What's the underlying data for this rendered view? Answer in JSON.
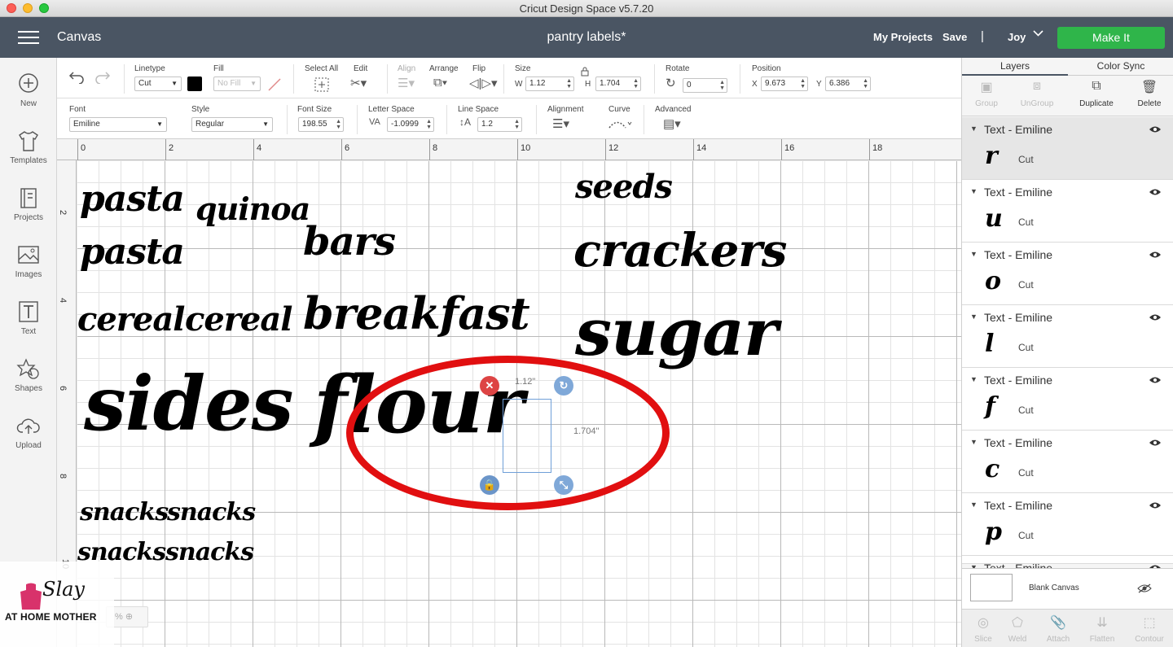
{
  "window": {
    "title": "Cricut Design Space  v5.7.20"
  },
  "header": {
    "section": "Canvas",
    "project_name": "pantry labels*",
    "my_projects": "My Projects",
    "save": "Save",
    "separator": "|",
    "user": "Joy",
    "make_it": "Make It"
  },
  "sidebar": {
    "items": [
      {
        "label": "New",
        "icon": "plus-circle-icon"
      },
      {
        "label": "Templates",
        "icon": "shirt-icon"
      },
      {
        "label": "Projects",
        "icon": "projects-icon"
      },
      {
        "label": "Images",
        "icon": "image-icon"
      },
      {
        "label": "Text",
        "icon": "text-icon"
      },
      {
        "label": "Shapes",
        "icon": "shapes-icon"
      },
      {
        "label": "Upload",
        "icon": "upload-icon"
      }
    ]
  },
  "toolbar": {
    "linetype_label": "Linetype",
    "linetype_value": "Cut",
    "fill_label": "Fill",
    "fill_value": "No Fill",
    "select_all": "Select All",
    "edit": "Edit",
    "align": "Align",
    "arrange": "Arrange",
    "flip": "Flip",
    "size_label": "Size",
    "w_label": "W",
    "w_value": "1.12",
    "h_label": "H",
    "h_value": "1.704",
    "rotate_label": "Rotate",
    "rotate_value": "0",
    "position_label": "Position",
    "x_label": "X",
    "x_value": "9.673",
    "y_label": "Y",
    "y_value": "6.386",
    "swatch_color": "#000000"
  },
  "text_toolbar": {
    "font_label": "Font",
    "font_value": "Emiline",
    "style_label": "Style",
    "style_value": "Regular",
    "font_size_label": "Font Size",
    "font_size_value": "198.55",
    "letter_space_label": "Letter Space",
    "letter_space_value": "-1.0999",
    "line_space_label": "Line Space",
    "line_space_value": "1.2",
    "alignment_label": "Alignment",
    "curve_label": "Curve",
    "advanced_label": "Advanced"
  },
  "ruler": {
    "top": [
      "0",
      "2",
      "4",
      "6",
      "8",
      "10",
      "12",
      "14",
      "16",
      "18"
    ],
    "left": [
      "2",
      "4",
      "6",
      "8",
      "10"
    ]
  },
  "canvas": {
    "words": [
      "pasta",
      "quinoa",
      "pasta",
      "bars",
      "seeds",
      "crackers",
      "cereal",
      "cereal",
      "breakfast",
      "sugar",
      "sides",
      "flour",
      "snacks",
      "snacks",
      "snacks",
      "snacks"
    ],
    "selection": {
      "width_label": "1.12\"",
      "height_label": "1.704\""
    },
    "zoom": "%",
    "annotation_color": "#e10f10"
  },
  "panel": {
    "tabs": [
      "Layers",
      "Color Sync"
    ],
    "actions": [
      "Group",
      "UnGroup",
      "Duplicate",
      "Delete"
    ],
    "layers": [
      {
        "name": "Text - Emiline",
        "glyph": "r",
        "op": "Cut"
      },
      {
        "name": "Text - Emiline",
        "glyph": "u",
        "op": "Cut"
      },
      {
        "name": "Text - Emiline",
        "glyph": "o",
        "op": "Cut"
      },
      {
        "name": "Text - Emiline",
        "glyph": "l",
        "op": "Cut"
      },
      {
        "name": "Text - Emiline",
        "glyph": "f",
        "op": "Cut"
      },
      {
        "name": "Text - Emiline",
        "glyph": "c",
        "op": "Cut"
      },
      {
        "name": "Text - Emiline",
        "glyph": "p",
        "op": "Cut"
      },
      {
        "name": "Text - Emiline",
        "glyph": "",
        "op": ""
      }
    ],
    "blank_canvas": "Blank Canvas",
    "bottom_actions": [
      "Slice",
      "Weld",
      "Attach",
      "Flatten",
      "Contour"
    ]
  },
  "watermark": {
    "script": "Slay",
    "caps": "AT HOME MOTHER"
  }
}
